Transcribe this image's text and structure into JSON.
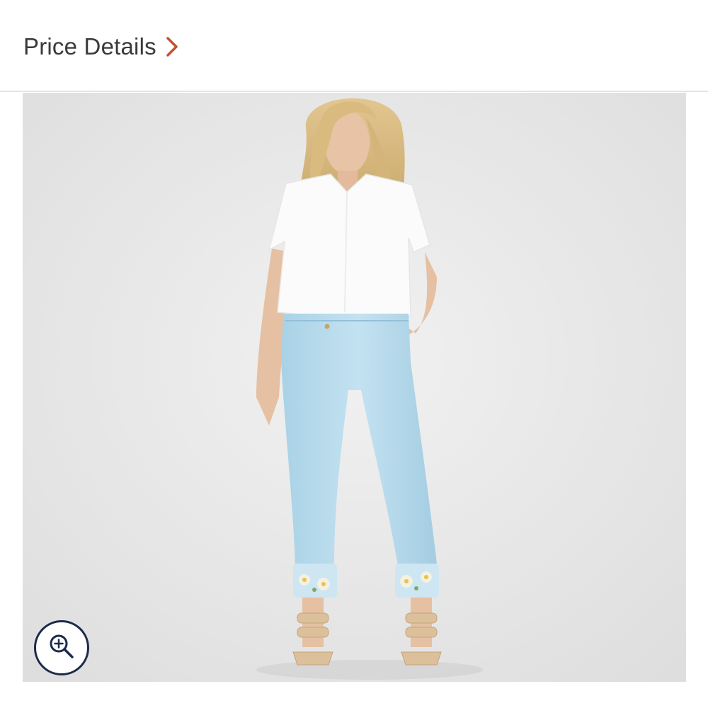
{
  "header": {
    "price_details_label": "Price Details",
    "chevron_icon": "chevron-right-icon",
    "accent_color": "#c8502a"
  },
  "product_image": {
    "zoom_icon": "zoom-in-icon"
  }
}
